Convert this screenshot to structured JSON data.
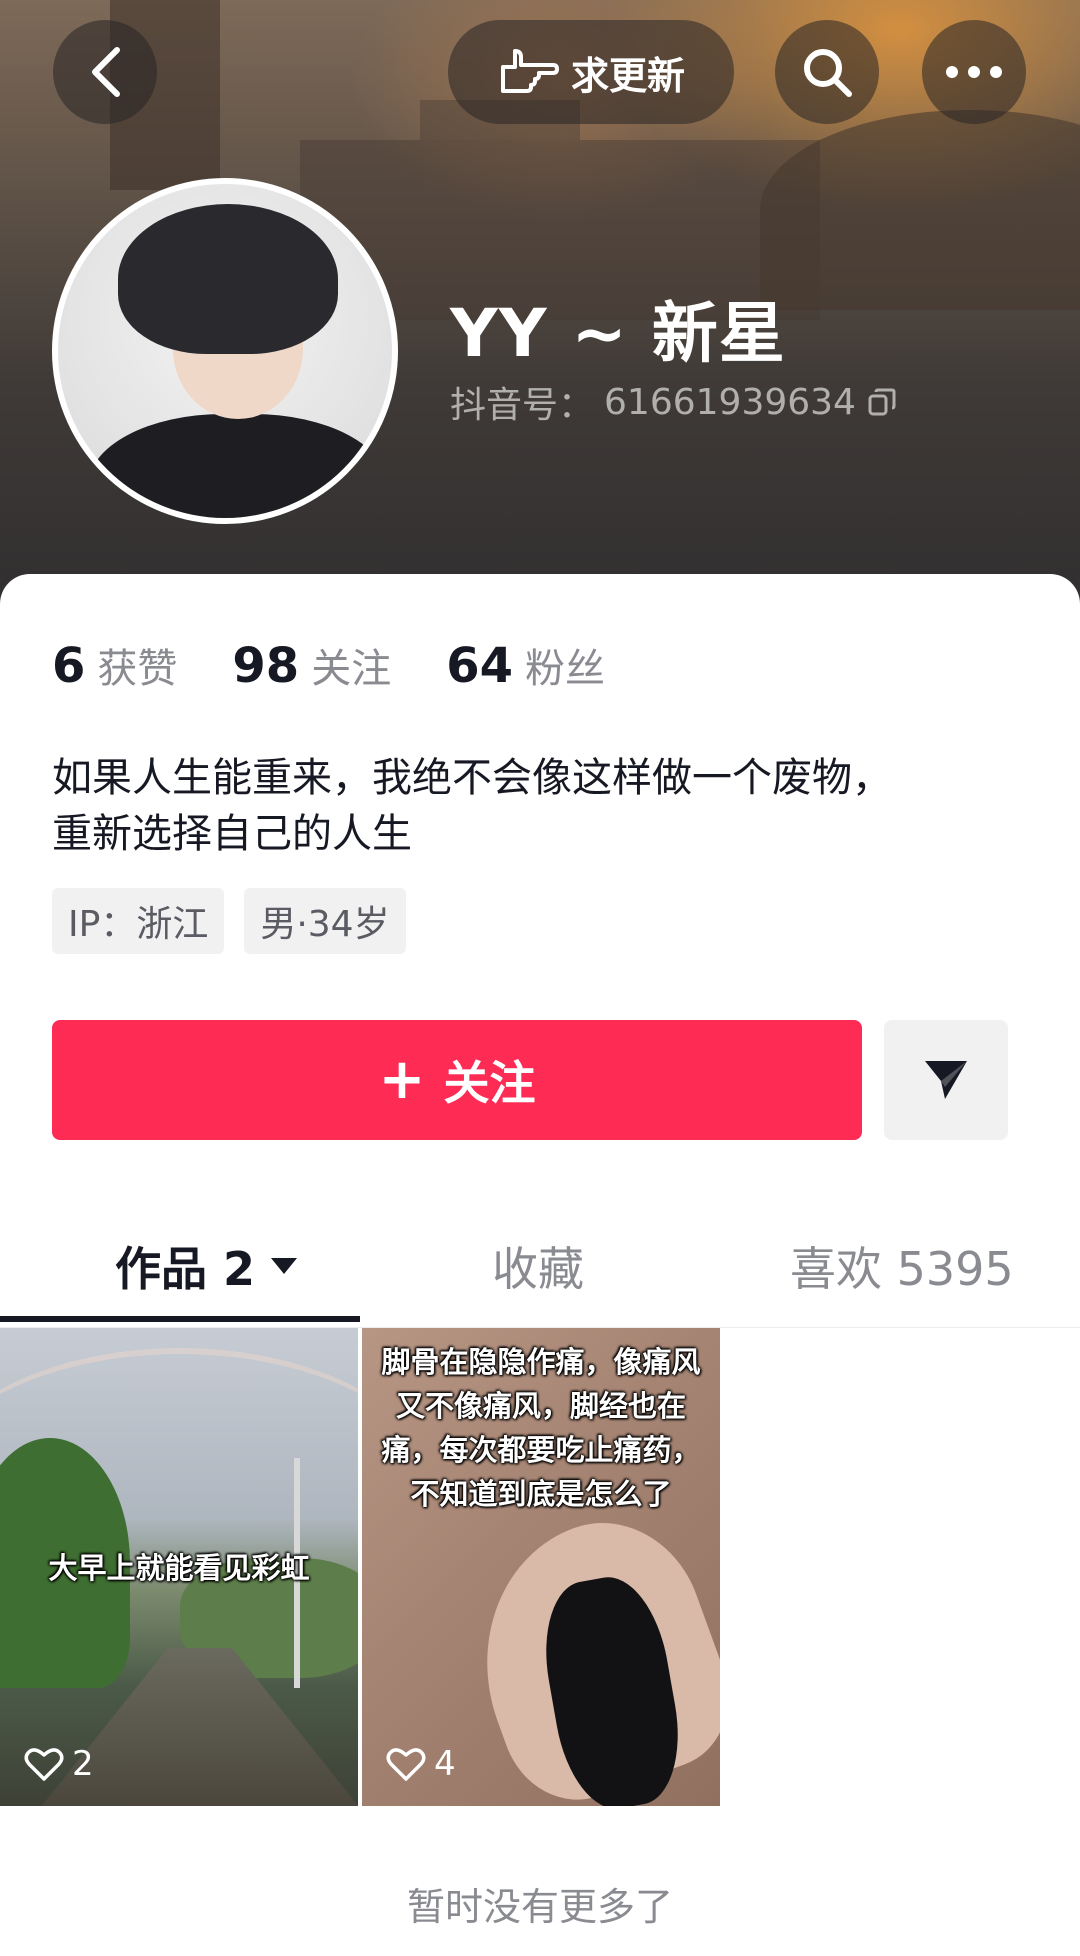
{
  "header": {
    "update_label": "求更新",
    "username": "YY ~ 新星",
    "douyin_id_label": "抖音号：",
    "douyin_id": "61661939634"
  },
  "stats": [
    {
      "num": "6",
      "label": "获赞"
    },
    {
      "num": "98",
      "label": "关注"
    },
    {
      "num": "64",
      "label": "粉丝"
    }
  ],
  "bio": {
    "line1": "如果人生能重来，我绝不会像这样做一个废物，",
    "line2": "重新选择自己的人生"
  },
  "tags": [
    "IP：浙江",
    "男·34岁"
  ],
  "actions": {
    "follow_plus": "+",
    "follow_label": "关注"
  },
  "tabs": {
    "works": "作品 2",
    "favorites": "收藏",
    "likes": "喜欢 5395"
  },
  "videos": [
    {
      "caption": "大早上就能看见彩虹",
      "likes": "2"
    },
    {
      "caption": "脚骨在隐隐作痛，像痛风又不像痛风，脚经也在痛，每次都要吃止痛药，不知道到底是怎么了",
      "likes": "4"
    }
  ],
  "footer": {
    "no_more": "暂时没有更多了"
  },
  "colors": {
    "accent": "#fe2c55",
    "text": "#161823",
    "muted": "#8a8b91"
  },
  "icons": [
    "back-icon",
    "hand-point-icon",
    "search-icon",
    "more-icon",
    "copy-icon",
    "send-icon",
    "caret-down-icon",
    "heart-icon"
  ]
}
